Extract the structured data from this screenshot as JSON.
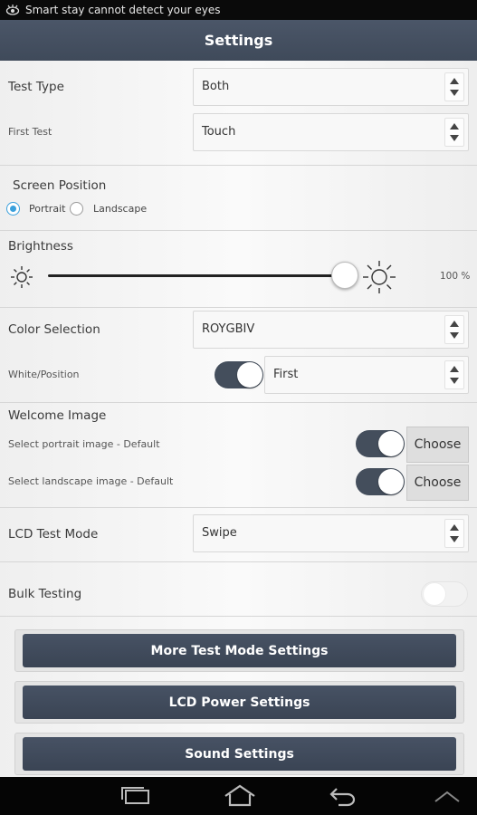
{
  "status": {
    "text": "Smart stay cannot detect your eyes",
    "icon": "eye-icon"
  },
  "header": {
    "title": "Settings"
  },
  "test_type": {
    "label": "Test Type",
    "value": "Both"
  },
  "first_test": {
    "label": "First Test",
    "value": "Touch"
  },
  "screen_position": {
    "label": "Screen Position",
    "options": [
      "Portrait",
      "Landscape"
    ],
    "selected": "Portrait"
  },
  "brightness": {
    "label": "Brightness",
    "value_text": "100 %",
    "level": 1.0,
    "icons": [
      "sun-low-icon",
      "sun-high-icon"
    ]
  },
  "color_selection": {
    "label": "Color Selection",
    "value": "ROYGBIV"
  },
  "white_position": {
    "label": "White/Position",
    "toggle": true,
    "value": "First"
  },
  "welcome_image": {
    "label": "Welcome Image",
    "portrait": {
      "label": "Select portrait image - Default",
      "toggle": true,
      "button": "Choose"
    },
    "landscape": {
      "label": "Select landscape image - Default",
      "toggle": true,
      "button": "Choose"
    }
  },
  "lcd_test_mode": {
    "label": "LCD Test Mode",
    "value": "Swipe"
  },
  "bulk_testing": {
    "label": "Bulk Testing",
    "toggle": false
  },
  "buttons": {
    "more_test_mode": "More Test Mode Settings",
    "lcd_power": "LCD Power Settings",
    "sound": "Sound Settings"
  },
  "nav": {
    "icons": [
      "recent-apps-icon",
      "home-icon",
      "back-icon",
      "up-chevron-icon"
    ]
  },
  "colors": {
    "action_bar": "#434e5f",
    "accent_radio": "#3aa0dc",
    "toggle_on": "#444e5c"
  }
}
